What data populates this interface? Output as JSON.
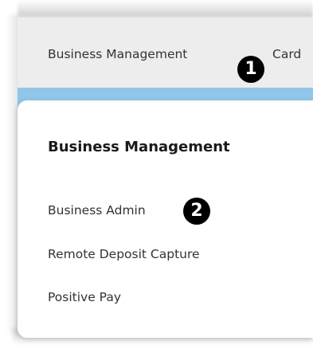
{
  "nav": {
    "items": [
      {
        "label": "Business Management"
      },
      {
        "label": "Card"
      }
    ]
  },
  "dropdown": {
    "title": "Business Management",
    "items": [
      {
        "label": "Business Admin"
      },
      {
        "label": "Remote Deposit Capture"
      },
      {
        "label": "Positive Pay"
      }
    ]
  },
  "callouts": [
    "1",
    "2"
  ],
  "colors": {
    "navbar_bg": "#ededed",
    "accent_strip": "#8fc6ea",
    "callout_bg": "#000000"
  }
}
